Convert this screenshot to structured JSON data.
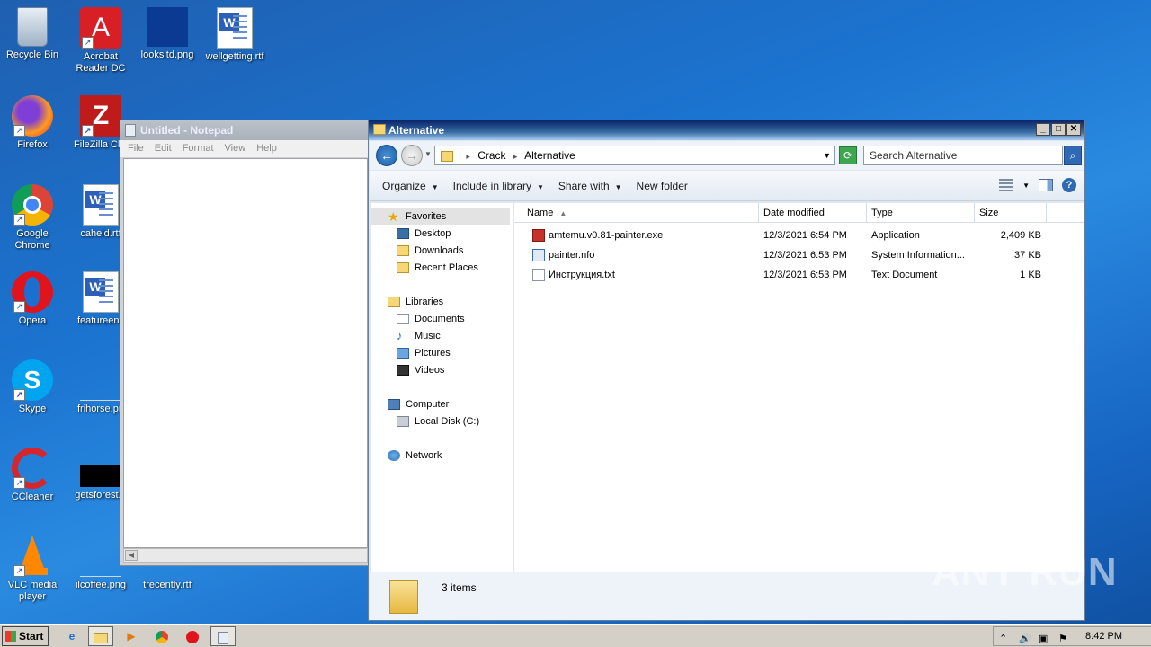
{
  "desktop": {
    "icons": [
      {
        "label": "Recycle Bin"
      },
      {
        "label": "Acrobat Reader DC"
      },
      {
        "label": "looksltd.png"
      },
      {
        "label": "wellgetting.rtf"
      },
      {
        "label": "Firefox"
      },
      {
        "label": "FileZilla Clie"
      },
      {
        "label": "Google Chrome"
      },
      {
        "label": "caheld.rtf"
      },
      {
        "label": "Opera"
      },
      {
        "label": "featureenti"
      },
      {
        "label": "Skype"
      },
      {
        "label": "frihorse.pn"
      },
      {
        "label": "CCleaner"
      },
      {
        "label": "getsforest.p"
      },
      {
        "label": "VLC media player"
      },
      {
        "label": "ilcoffee.png"
      },
      {
        "label": "trecently.rtf"
      }
    ]
  },
  "notepad": {
    "title": "Untitled - Notepad",
    "menu": [
      "File",
      "Edit",
      "Format",
      "View",
      "Help"
    ]
  },
  "explorer": {
    "title": "Alternative",
    "breadcrumb": [
      "Crack",
      "Alternative"
    ],
    "search_placeholder": "Search Alternative",
    "commands": {
      "organize": "Organize",
      "include": "Include in library",
      "share": "Share with",
      "new_folder": "New folder"
    },
    "nav": {
      "favorites": "Favorites",
      "desktop": "Desktop",
      "downloads": "Downloads",
      "recent": "Recent Places",
      "libraries": "Libraries",
      "documents": "Documents",
      "music": "Music",
      "pictures": "Pictures",
      "videos": "Videos",
      "computer": "Computer",
      "local_disk": "Local Disk (C:)",
      "network": "Network"
    },
    "columns": {
      "name": "Name",
      "date": "Date modified",
      "type": "Type",
      "size": "Size"
    },
    "files": [
      {
        "name": "amtemu.v0.81-painter.exe",
        "date": "12/3/2021 6:54 PM",
        "type": "Application",
        "size": "2,409 KB"
      },
      {
        "name": "painter.nfo",
        "date": "12/3/2021 6:53 PM",
        "type": "System Information...",
        "size": "37 KB"
      },
      {
        "name": "Инструкция.txt",
        "date": "12/3/2021 6:53 PM",
        "type": "Text Document",
        "size": "1 KB"
      }
    ],
    "status": "3 items"
  },
  "watermark": "ANY RUN",
  "taskbar": {
    "start": "Start",
    "clock": "8:42 PM"
  },
  "colors": {
    "desktop_bg": "#1b74d0",
    "title_active": "#0a246a",
    "title_inactive": "#a9b0b9"
  }
}
